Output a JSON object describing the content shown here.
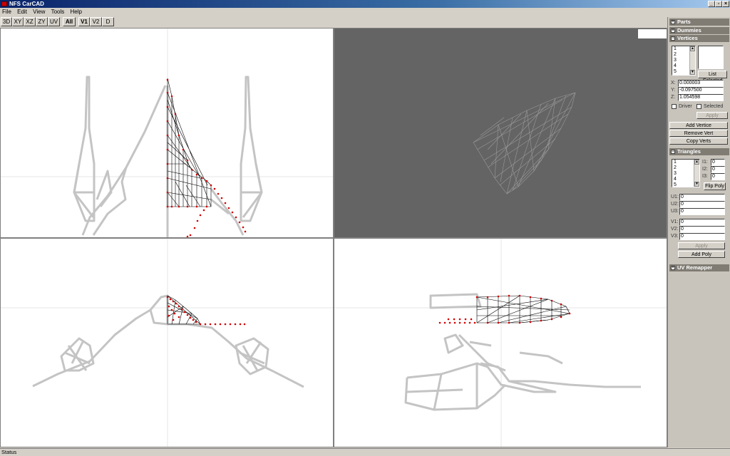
{
  "window": {
    "title": "NFS CarCAD",
    "min": "_",
    "max": "▫",
    "close": "×"
  },
  "menu": [
    "File",
    "Edit",
    "View",
    "Tools",
    "Help"
  ],
  "toolbar": [
    "3D",
    "XY",
    "XZ",
    "ZY",
    "UV",
    "All",
    "V1",
    "V2",
    "D"
  ],
  "panel": {
    "parts": "Parts",
    "dummies": "Dummies",
    "vertices": {
      "title": "Vertices",
      "list": [
        "1",
        "2",
        "3",
        "4",
        "5"
      ],
      "list_selected": "List Selected",
      "x_label": "X:",
      "x": "0.000003",
      "y_label": "Y:",
      "y": "-0.097500",
      "z_label": "Z:",
      "z": "1.054598",
      "driver": "Driver",
      "selected": "Selected",
      "apply": "Apply",
      "add": "Add Vertice",
      "remove": "Remove Vert",
      "copy": "Copy Verts"
    },
    "triangles": {
      "title": "Triangles",
      "list": [
        "1",
        "2",
        "3",
        "4",
        "5"
      ],
      "i1_label": "I1:",
      "i1": "0",
      "i2_label": "I2:",
      "i2": "0",
      "i3_label": "I3:",
      "i3": "0",
      "flip": "Flip Poly",
      "u1_label": "U1:",
      "u1": "0",
      "u2_label": "U2:",
      "u2": "0",
      "u3_label": "U3:",
      "u3": "0",
      "v1_label": "V1:",
      "v1": "0",
      "v2_label": "V2:",
      "v2": "0",
      "v3_label": "V3:",
      "v3": "0",
      "apply": "Apply",
      "add": "Add Poly"
    },
    "uv": "UV Remapper"
  },
  "status": "Status",
  "colors": {
    "mesh": "#c8c8c8",
    "wire": "#000000",
    "vertex": "#d40000",
    "view3d_bg": "#646464"
  }
}
